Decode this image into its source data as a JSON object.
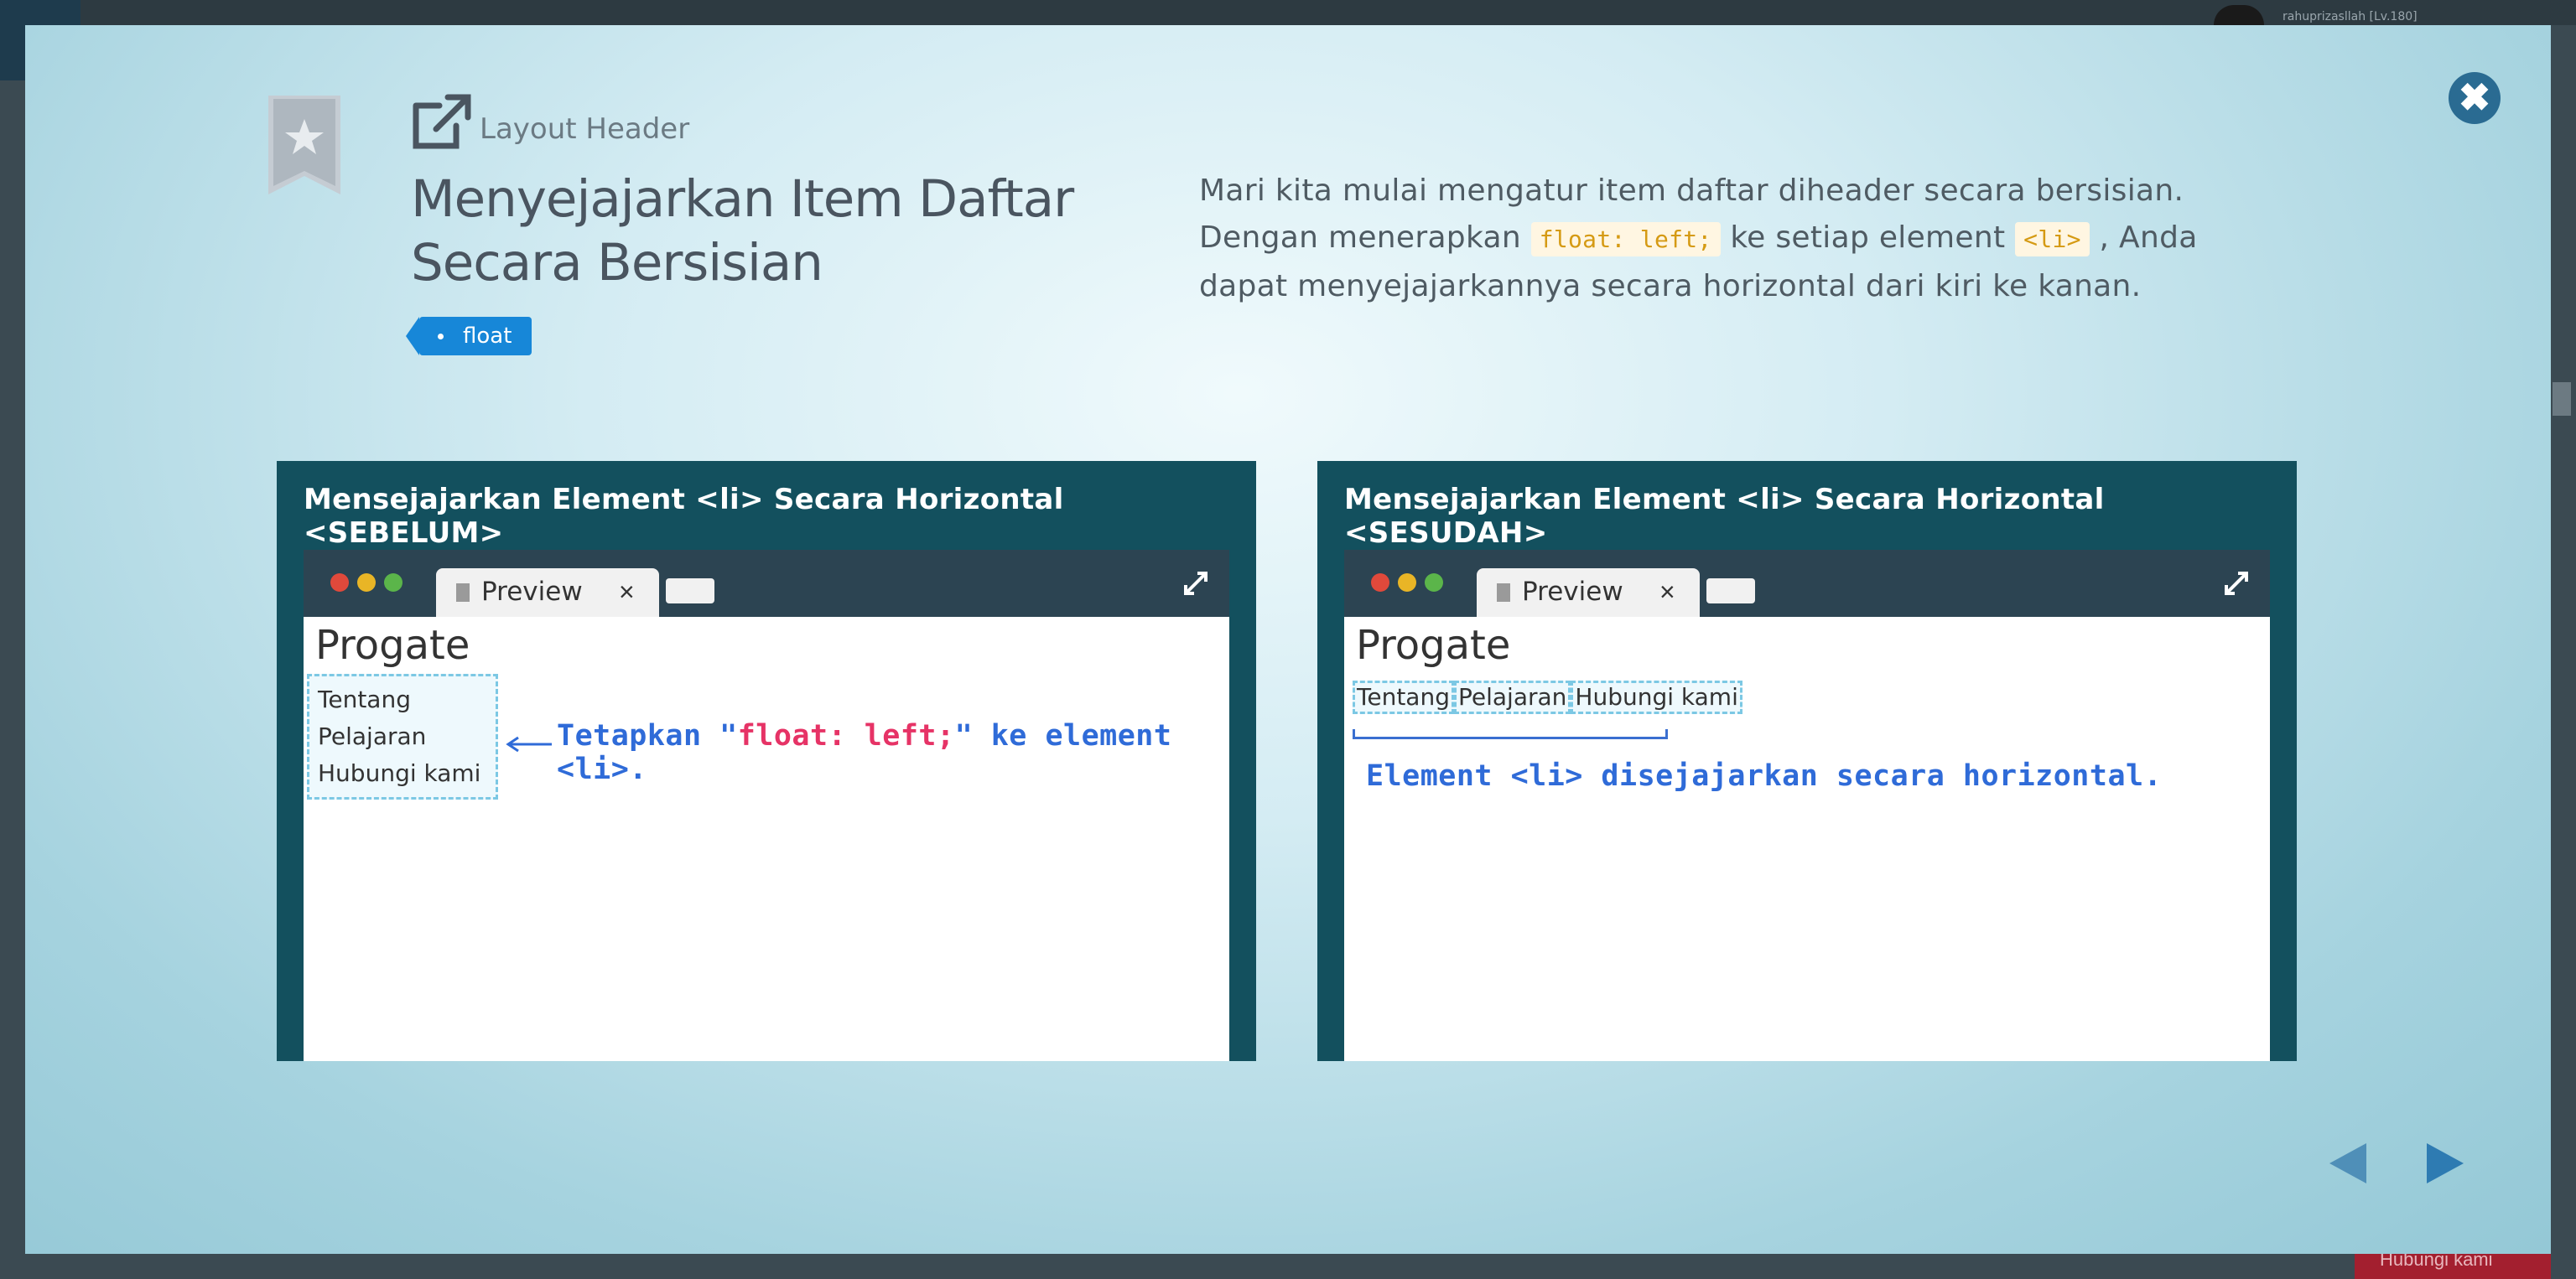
{
  "backdrop": {
    "user_name": "rahuprizasllah [Lv.180]",
    "bottom_button": "Hubungi kami"
  },
  "modal": {
    "section_label": "Layout Header",
    "title": "Menyejajarkan Item Daftar Secara Bersisian",
    "tag": "float",
    "description": {
      "part1": "Mari kita mulai mengatur item daftar diheader secara bersisian. Dengan menerapkan ",
      "code1": "float: left;",
      "part2": " ke setiap element ",
      "code2": "<li>",
      "part3": " , Anda dapat menyejajarkannya secara horizontal dari kiri ke kanan."
    },
    "close_icon": "close-icon"
  },
  "panels": {
    "before": {
      "title": "Mensejajarkan Element <li> Secara Horizontal <SEBELUM>",
      "tab_label": "Preview",
      "tab_close": "×",
      "site_title": "Progate",
      "items": [
        "Tentang",
        "Pelajaran",
        "Hubungi kami"
      ],
      "note_a": "Tetapkan \"",
      "note_hl": "float: left;",
      "note_b": "\" ke element <li>."
    },
    "after": {
      "title": "Mensejajarkan Element <li> Secara Horizontal <SESUDAH>",
      "tab_label": "Preview",
      "tab_close": "×",
      "site_title": "Progate",
      "items": [
        "Tentang",
        "Pelajaran",
        "Hubungi kami"
      ],
      "note": "Element <li> disejajarkan secara horizontal."
    }
  },
  "navigation": {
    "prev_icon": "triangle-left-icon",
    "next_icon": "triangle-right-icon"
  },
  "colors": {
    "accent": "#1787d8",
    "panel_bg": "#13505e",
    "close_bg": "#2a6b92",
    "annotation": "#2f6bd8",
    "highlight": "#e63366"
  }
}
